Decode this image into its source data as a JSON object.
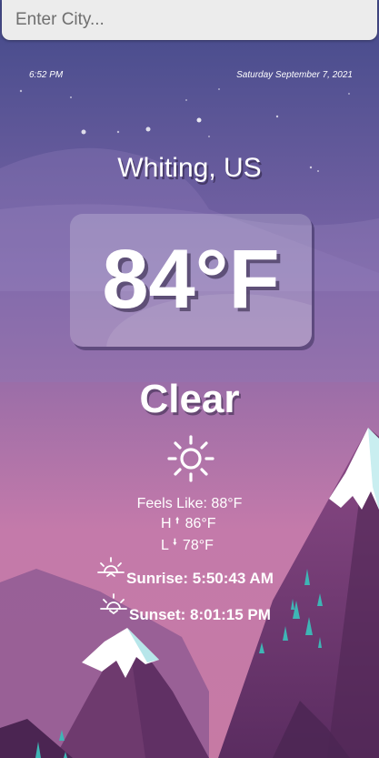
{
  "search": {
    "placeholder": "Enter City..."
  },
  "header": {
    "time": "6:52 PM",
    "date": "Saturday September 7, 2021"
  },
  "location": {
    "city": "Whiting, US"
  },
  "weather": {
    "temperature": "84°F",
    "condition": "Clear",
    "condition_icon": "sun-icon",
    "feels_like": "Feels Like: 88°F",
    "high_label": "H",
    "high_value": "86°F",
    "low_label": "L",
    "low_value": "78°F"
  },
  "sun": {
    "sunrise": "Sunrise: 5:50:43 AM",
    "sunset": "Sunset: 8:01:15 PM"
  },
  "colors": {
    "sky_top": "#4a4d8c",
    "sky_bottom": "#c97aa8",
    "mountain": "#6e3a6e",
    "snow": "#ffffff",
    "tree": "#3fb5b5"
  }
}
